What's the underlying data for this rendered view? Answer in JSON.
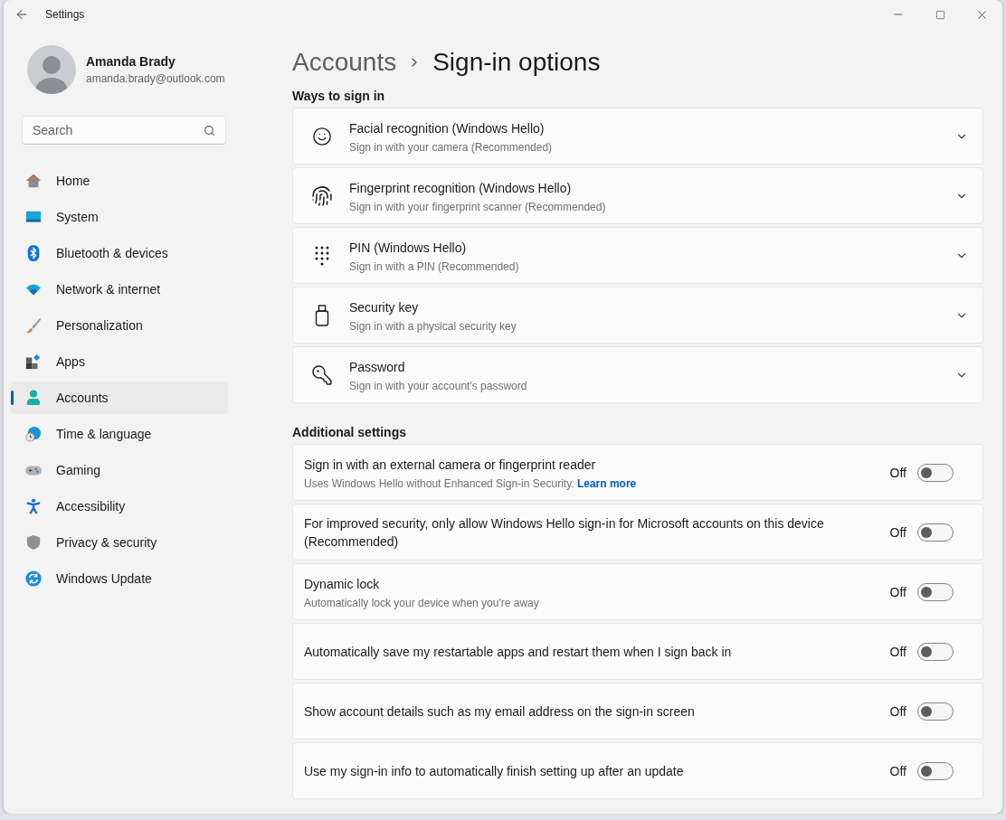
{
  "window": {
    "title": "Settings"
  },
  "profile": {
    "name": "Amanda Brady",
    "email": "amanda.brady@outlook.com"
  },
  "search": {
    "placeholder": "Search"
  },
  "sidebar": {
    "items": [
      {
        "kind": "home",
        "label": "Home",
        "selected": false
      },
      {
        "kind": "system",
        "label": "System",
        "selected": false
      },
      {
        "kind": "bluetooth",
        "label": "Bluetooth & devices",
        "selected": false
      },
      {
        "kind": "network",
        "label": "Network & internet",
        "selected": false
      },
      {
        "kind": "personalization",
        "label": "Personalization",
        "selected": false
      },
      {
        "kind": "apps",
        "label": "Apps",
        "selected": false
      },
      {
        "kind": "accounts",
        "label": "Accounts",
        "selected": true
      },
      {
        "kind": "time",
        "label": "Time & language",
        "selected": false
      },
      {
        "kind": "gaming",
        "label": "Gaming",
        "selected": false
      },
      {
        "kind": "accessibility",
        "label": "Accessibility",
        "selected": false
      },
      {
        "kind": "privacy",
        "label": "Privacy & security",
        "selected": false
      },
      {
        "kind": "update",
        "label": "Windows Update",
        "selected": false
      }
    ]
  },
  "breadcrumb": {
    "parent": "Accounts",
    "current": "Sign-in options"
  },
  "ways_to_sign_in": {
    "heading": "Ways to sign in",
    "items": [
      {
        "kind": "face",
        "title": "Facial recognition (Windows Hello)",
        "subtitle": "Sign in with your camera (Recommended)"
      },
      {
        "kind": "fingerprint",
        "title": "Fingerprint recognition (Windows Hello)",
        "subtitle": "Sign in with your fingerprint scanner (Recommended)"
      },
      {
        "kind": "pin",
        "title": "PIN (Windows Hello)",
        "subtitle": "Sign in with a PIN (Recommended)"
      },
      {
        "kind": "security_key",
        "title": "Security key",
        "subtitle": "Sign in with a physical security key"
      },
      {
        "kind": "password",
        "title": "Password",
        "subtitle": "Sign in with your account's password"
      }
    ]
  },
  "additional_settings": {
    "heading": "Additional settings",
    "items": [
      {
        "title": "Sign in with an external camera or fingerprint reader",
        "subtitle": "Uses Windows Hello without Enhanced Sign-in Security.",
        "link": "Learn more",
        "state_label": "Off",
        "on": false
      },
      {
        "title": "For improved security, only allow Windows Hello sign-in for Microsoft accounts on this device (Recommended)",
        "state_label": "Off",
        "on": false
      },
      {
        "title": "Dynamic lock",
        "subtitle": "Automatically lock your device when you're away",
        "state_label": "Off",
        "on": false
      },
      {
        "title": "Automatically save my restartable apps and restart them when I sign back in",
        "state_label": "Off",
        "on": false
      },
      {
        "title": "Show account details such as my email address on the sign-in screen",
        "state_label": "Off",
        "on": false
      },
      {
        "title": "Use my sign-in info to automatically finish setting up after an update",
        "state_label": "Off",
        "on": false
      }
    ]
  }
}
